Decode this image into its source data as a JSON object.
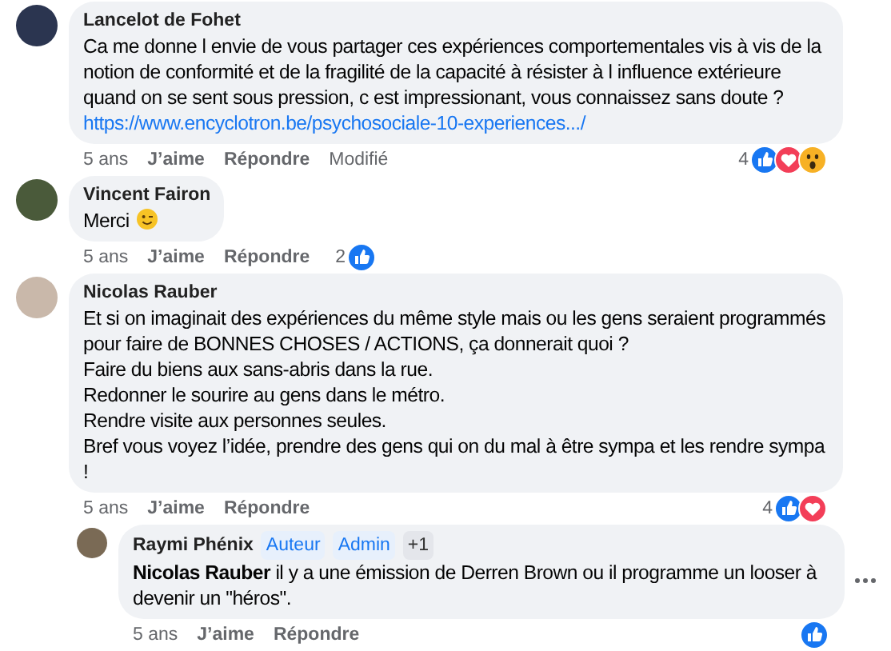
{
  "comments": [
    {
      "author": "Lancelot de Fohet",
      "text": "Ca me donne l envie de vous partager ces expériences comportementales vis à vis de la notion de conformité et de la fragilité de la capacité à résister à l influence extérieure quand on se sent sous pression, c est impressionant, vous connaissez sans doute ?",
      "link": "https://www.encyclotron.be/psychosociale-10-experiences.../",
      "meta": {
        "time": "5 ans",
        "like": "J’aime",
        "reply": "Répondre",
        "edited": "Modifié"
      },
      "reaction_count": "4",
      "reactions": [
        {
          "kind": "like"
        },
        {
          "kind": "love"
        },
        {
          "kind": "wow"
        }
      ]
    },
    {
      "author": "Vincent Fairon",
      "text": "Merci",
      "emoji": {
        "kind": "wink"
      },
      "meta": {
        "time": "5 ans",
        "like": "J’aime",
        "reply": "Répondre"
      },
      "reaction_count": "2",
      "reactions": [
        {
          "kind": "like"
        }
      ]
    },
    {
      "author": "Nicolas Rauber",
      "text": "Et si on imaginait des expériences du même style mais ou les gens seraient programmés pour faire de BONNES CHOSES / ACTIONS, ça donnerait quoi ?\nFaire du biens aux sans-abris dans la rue.\nRedonner le sourire au gens dans le métro.\nRendre visite aux personnes seules.\nBref vous voyez l’idée, prendre des gens qui on du mal à être sympa et les rendre sympa !",
      "meta": {
        "time": "5 ans",
        "like": "J’aime",
        "reply": "Répondre"
      },
      "reaction_count": "4",
      "reactions": [
        {
          "kind": "like"
        },
        {
          "kind": "love"
        }
      ],
      "replies": [
        {
          "author": "Raymi Phénix",
          "badges": [
            "Auteur",
            "Admin",
            "+1"
          ],
          "text": "**Nicolas Rauber** il y a une émission de Derren Brown ou il programme un looser à devenir un \"héros\".",
          "meta": {
            "time": "5 ans",
            "like": "J’aime",
            "reply": "Répondre"
          },
          "reactions": [
            {
              "kind": "like"
            }
          ]
        }
      ]
    }
  ]
}
